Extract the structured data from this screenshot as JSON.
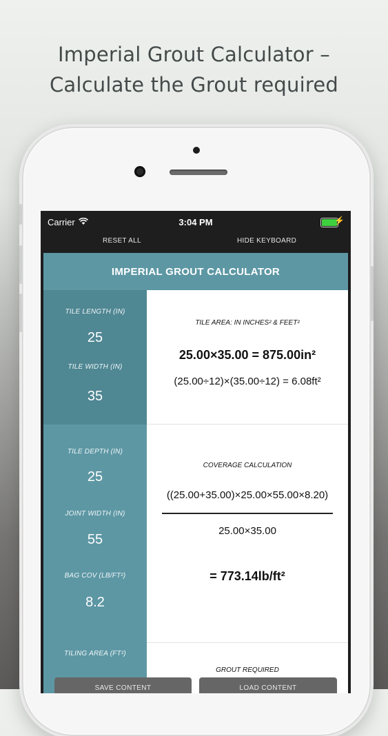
{
  "headline": {
    "line1": "Imperial Grout Calculator –",
    "line2": "Calculate the Grout required"
  },
  "statusbar": {
    "carrier": "Carrier",
    "time": "3:04 PM",
    "icons": [
      "wifi-icon",
      "battery-icon",
      "charging-bolt-icon"
    ]
  },
  "navbar": {
    "reset": "RESET ALL",
    "hide_keyboard": "HIDE KEYBOARD"
  },
  "title": "IMPERIAL GROUT CALCULATOR",
  "inputs": {
    "tile_length": {
      "label": "TILE LENGTH (IN)",
      "value": "25"
    },
    "tile_width": {
      "label": "TILE WIDTH (IN)",
      "value": "35"
    },
    "tile_depth": {
      "label": "TILE DEPTH (IN)",
      "value": "25"
    },
    "joint_width": {
      "label": "JOINT WIDTH (IN)",
      "value": "55"
    },
    "bag_cov": {
      "label": "BAG COV (LB/FT²)",
      "value": "8.2"
    },
    "tiling_area": {
      "label": "TILING AREA (FT²)"
    }
  },
  "results": {
    "tile_area": {
      "label": "TILE AREA: IN INCHES² & FEET²",
      "line1": "25.00×35.00 = 875.00in²",
      "line2": "(25.00÷12)×(35.00÷12) = 6.08ft²"
    },
    "coverage": {
      "label": "COVERAGE CALCULATION",
      "numerator": "((25.00+35.00)×25.00×55.00×8.20)",
      "denominator": "25.00×35.00",
      "result": "= 773.14lb/ft²"
    },
    "grout_required": {
      "label": "GROUT REQUIRED"
    }
  },
  "buttons": {
    "save": "SAVE CONTENT",
    "load": "LOAD CONTENT"
  },
  "colors": {
    "accent": "#5d97a4",
    "accent_dark": "#4f8793"
  }
}
